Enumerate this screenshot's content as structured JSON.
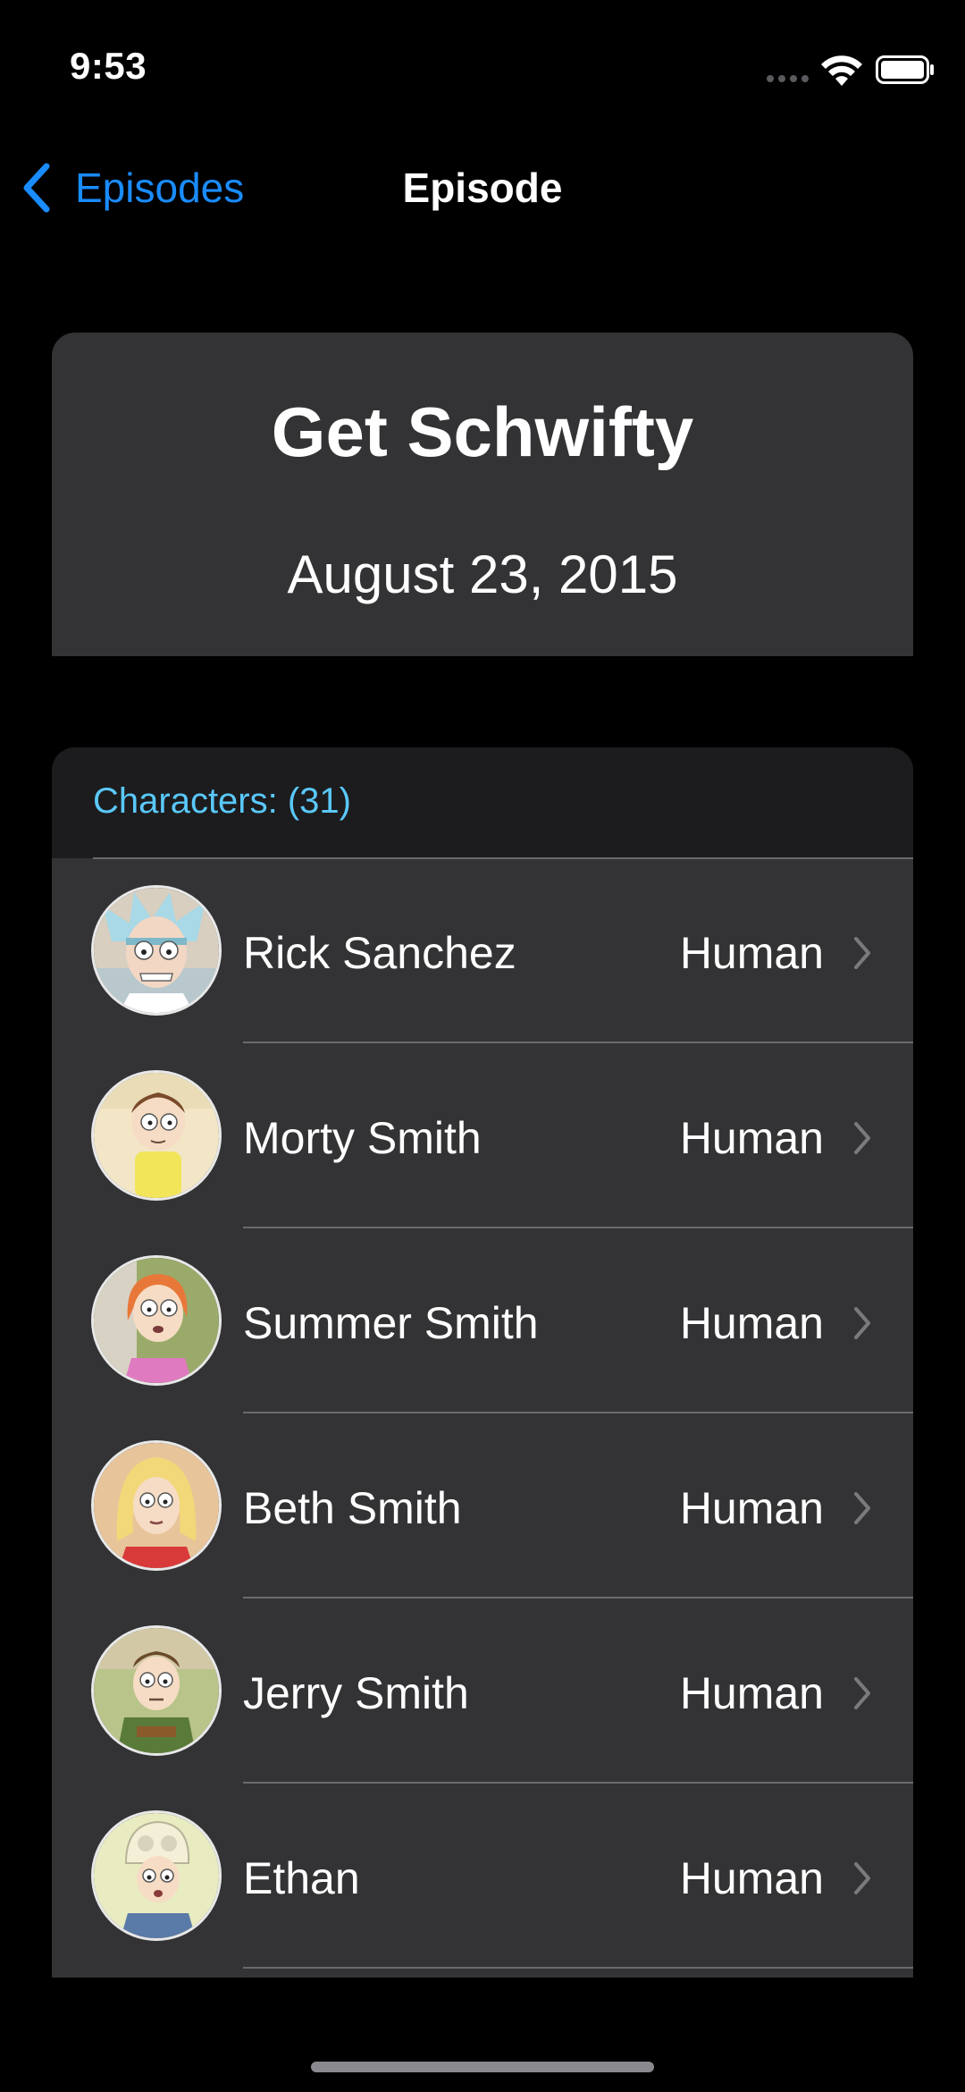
{
  "status_bar": {
    "time": "9:53",
    "signal_icon": "cellular-signal-icon",
    "wifi_icon": "wifi-icon",
    "battery_icon": "battery-icon"
  },
  "nav": {
    "back_label": "Episodes",
    "back_icon": "chevron-left-icon",
    "title": "Episode",
    "accent_color": "#1a8cff"
  },
  "episode": {
    "name": "Get Schwifty",
    "air_date": "August 23, 2015"
  },
  "characters": {
    "header": "Characters: (31)",
    "header_color": "#5ac8fa",
    "items": [
      {
        "name": "Rick Sanchez",
        "species": "Human",
        "avatar": "rick-avatar"
      },
      {
        "name": "Morty Smith",
        "species": "Human",
        "avatar": "morty-avatar"
      },
      {
        "name": "Summer Smith",
        "species": "Human",
        "avatar": "summer-avatar"
      },
      {
        "name": "Beth Smith",
        "species": "Human",
        "avatar": "beth-avatar"
      },
      {
        "name": "Jerry Smith",
        "species": "Human",
        "avatar": "jerry-avatar"
      },
      {
        "name": "Ethan",
        "species": "Human",
        "avatar": "ethan-avatar"
      }
    ]
  }
}
